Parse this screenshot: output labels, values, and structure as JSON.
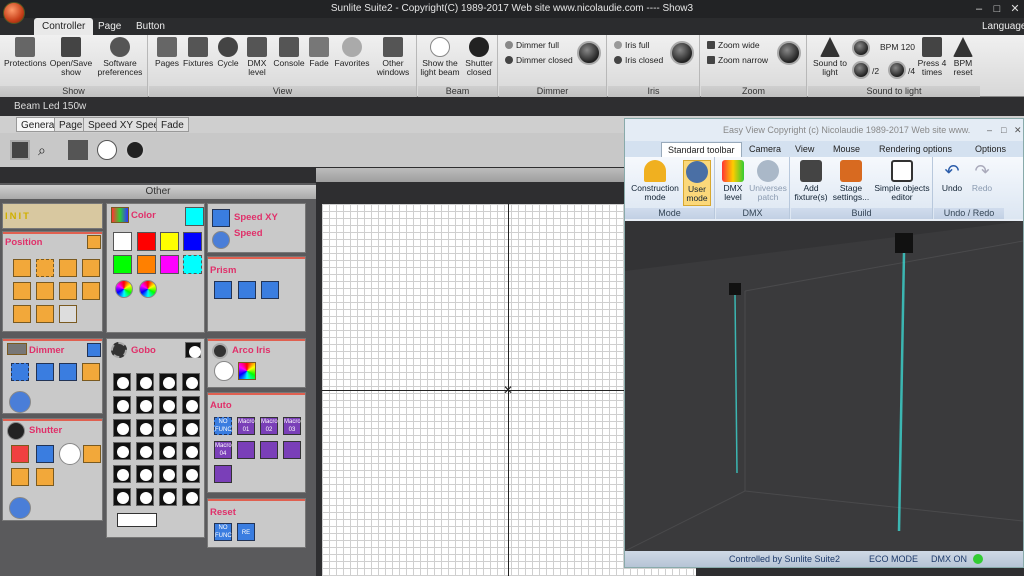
{
  "window": {
    "title": "Sunlite Suite2 - Copyright(C) 1989-2017    Web site www.nicolaudie.com ---- Show3",
    "language": "Language"
  },
  "ribbon_tabs": [
    "Controller",
    "Page",
    "Button"
  ],
  "groups": {
    "show": {
      "label": "Show",
      "items": [
        "Protections",
        "Open/Save show",
        "Software preferences"
      ]
    },
    "view": {
      "label": "View",
      "items": [
        "Pages",
        "Fixtures",
        "Cycle",
        "DMX level",
        "Console",
        "Fade",
        "Favorites",
        "Other windows"
      ]
    },
    "beam": {
      "label": "Beam",
      "items": [
        "Show the light beam",
        "Shutter closed"
      ]
    },
    "dimmer": {
      "label": "Dimmer",
      "items": [
        "Dimmer full",
        "Dimmer closed"
      ]
    },
    "iris": {
      "label": "Iris",
      "items": [
        "Iris full",
        "Iris closed"
      ]
    },
    "zoom": {
      "label": "Zoom",
      "items": [
        "Zoom wide",
        "Zoom narrow"
      ]
    },
    "sound": {
      "label": "Sound to light",
      "items": [
        "Sound to light",
        "BPM 120",
        "/2",
        "/4",
        "Press 4 times",
        "BPM reset"
      ]
    }
  },
  "fixture_name": "Beam Led 150w",
  "page_tabs": [
    "General",
    "Page",
    "Speed XY Speed",
    "Fade"
  ],
  "general_header": "General",
  "other_header": "Other",
  "palettes": {
    "init": "INIT",
    "position": "Position",
    "dimmer": "Dimmer",
    "shutter": "Shutter",
    "color": "Color",
    "gobo": "Gobo",
    "speed": "Speed XY Speed",
    "prism": "Prism",
    "arco": "Arco Iris",
    "auto": "Auto",
    "reset": "Reset"
  },
  "colors": [
    "#ffffff",
    "#ff0000",
    "#ffff00",
    "#0000ff",
    "#00ff00",
    "#ff8000",
    "#ff00ff",
    "#00ffff"
  ],
  "auto_macros": [
    "NO FUNC",
    "Macro 01",
    "Macro 02",
    "Macro 03",
    "Macro 04"
  ],
  "easy_view": {
    "title": "Easy View   Copyright (c) Nicolaudie 1989-2017    Web site www.",
    "tabs": [
      "Standard toolbar",
      "Camera",
      "View",
      "Mouse",
      "Rendering options"
    ],
    "options": "Options",
    "groups": {
      "mode": {
        "label": "Mode",
        "items": [
          "Construction mode",
          "User mode"
        ]
      },
      "dmx": {
        "label": "DMX",
        "items": [
          "DMX level",
          "Universes patch"
        ]
      },
      "build": {
        "label": "Build",
        "items": [
          "Add fixture(s)",
          "Stage settings...",
          "Simple objects editor"
        ]
      },
      "undo": {
        "label": "Undo / Redo",
        "items": [
          "Undo",
          "Redo"
        ]
      }
    },
    "status": {
      "controlled": "Controlled by Sunlite Suite2",
      "eco": "ECO MODE",
      "dmx": "DMX ON"
    }
  }
}
